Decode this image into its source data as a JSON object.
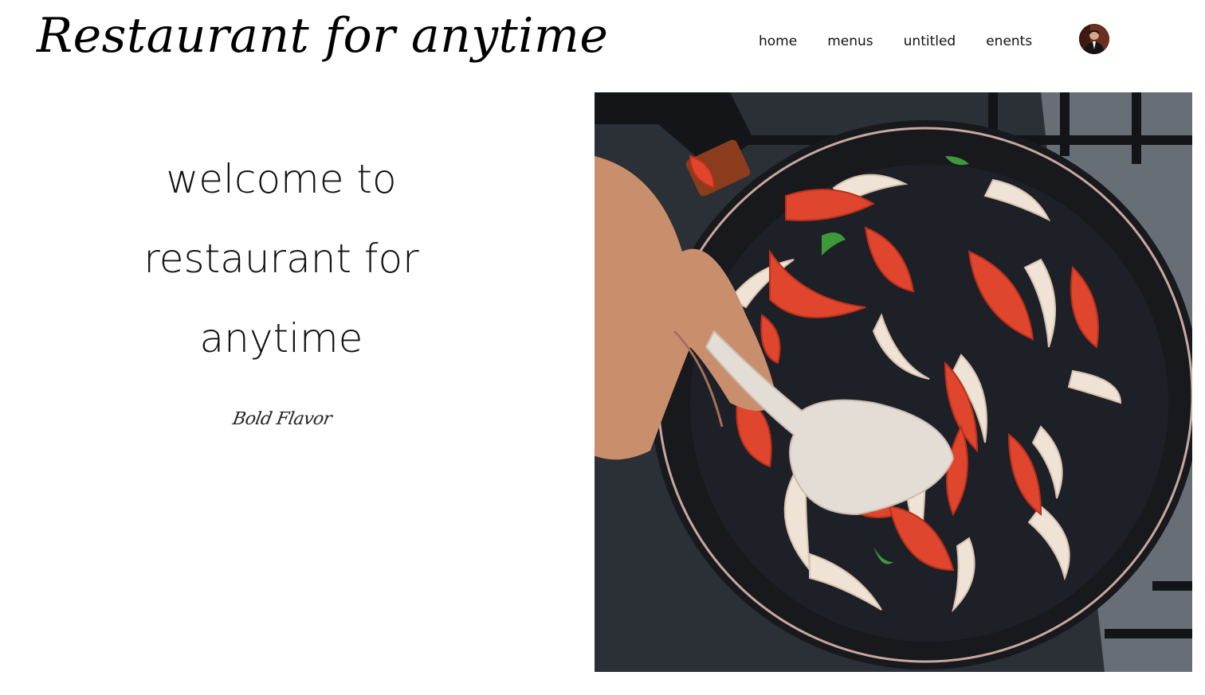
{
  "header": {
    "site_title": "Restaurant for anytime",
    "nav": [
      {
        "label": "home"
      },
      {
        "label": "menus"
      },
      {
        "label": "untitled"
      },
      {
        "label": "enents"
      }
    ],
    "avatar_icon": "user-avatar-photo"
  },
  "hero": {
    "heading": "welcome to restaurant for anytime",
    "tagline": "Bold Flavor",
    "image_subject": "pan-with-tomatoes-and-onions-photo"
  },
  "colors": {
    "background": "#ffffff",
    "text": "#111111",
    "pan": "#1b1d22",
    "tomato": "#e0452e",
    "onion": "#efe3d6"
  }
}
